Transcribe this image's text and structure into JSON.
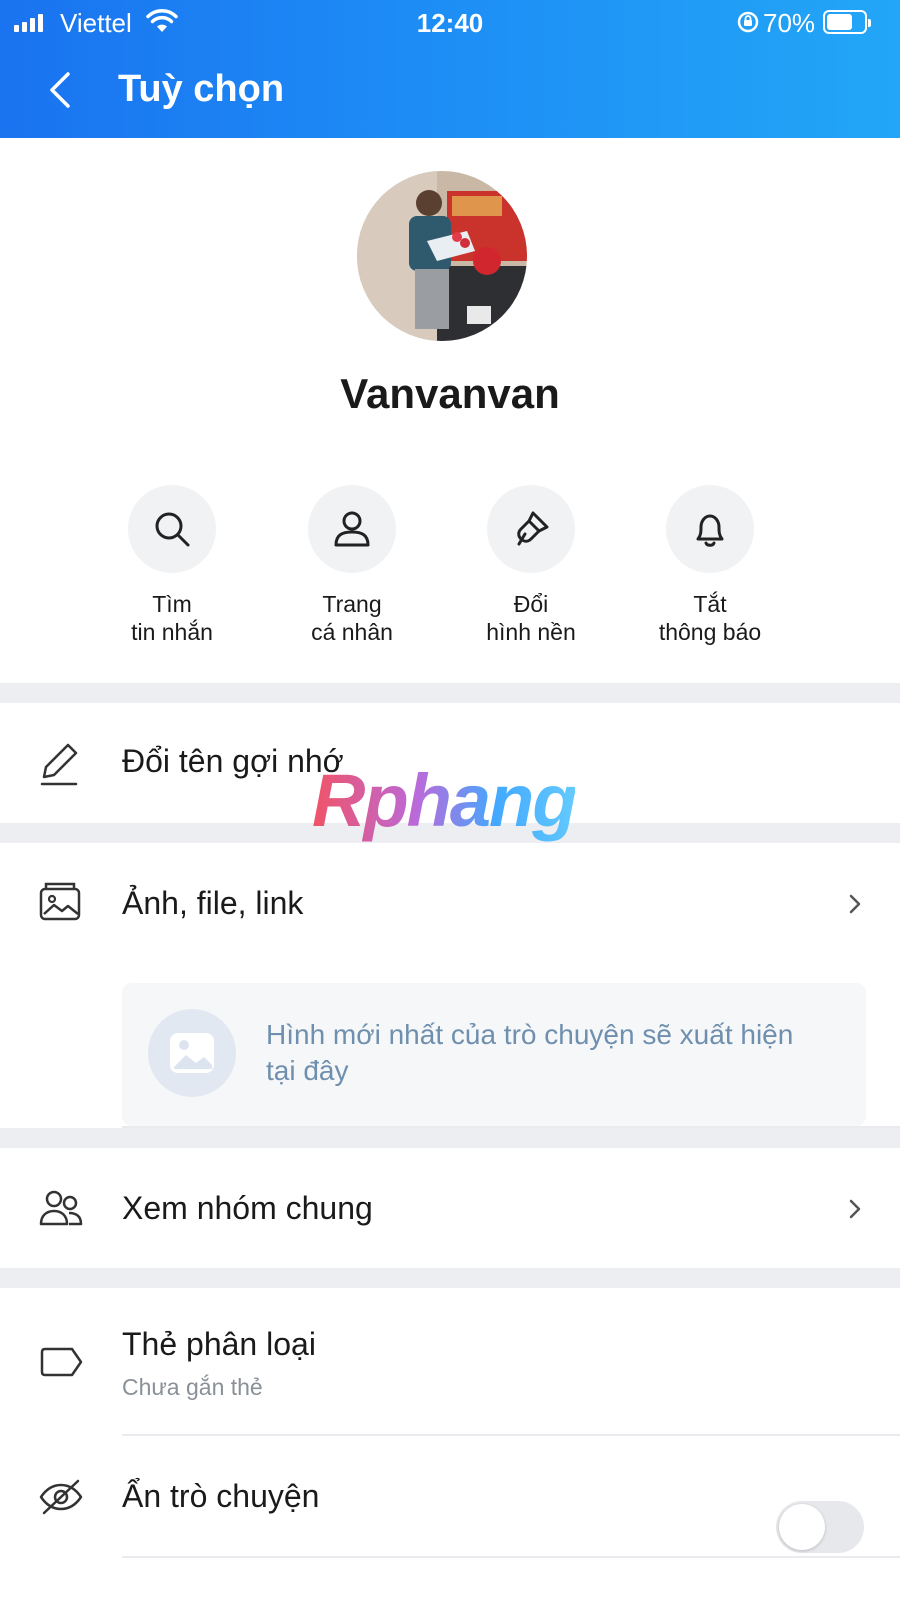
{
  "status_bar": {
    "carrier": "Viettel",
    "time": "12:40",
    "battery": "70%",
    "battery_level": 0.7
  },
  "header": {
    "title": "Tuỳ chọn",
    "back_icon": "chevron-left-icon"
  },
  "profile": {
    "name": "Vanvanvan"
  },
  "quick_actions": [
    {
      "line1": "Tìm",
      "line2": "tin nhắn",
      "icon": "search-icon"
    },
    {
      "line1": "Trang",
      "line2": "cá nhân",
      "icon": "user-icon"
    },
    {
      "line1": "Đổi",
      "line2": "hình nền",
      "icon": "paint-brush-icon"
    },
    {
      "line1": "Tắt",
      "line2": "thông báo",
      "icon": "bell-icon"
    }
  ],
  "menu": {
    "rename": {
      "label": "Đổi tên gợi nhớ"
    },
    "media": {
      "label": "Ảnh, file, link",
      "placeholder": "Hình mới nhất của trò chuyện sẽ xuất hiện tại đây"
    },
    "groups": {
      "label": "Xem nhóm chung"
    },
    "tags": {
      "label": "Thẻ phân loại",
      "sub": "Chưa gắn thẻ"
    },
    "hide": {
      "label": "Ẩn trò chuyện",
      "enabled": false
    }
  },
  "watermark": "Rphang",
  "colors": {
    "header_start": "#1a73f0",
    "header_end": "#22a6f7",
    "media_text": "#6f8fae"
  }
}
